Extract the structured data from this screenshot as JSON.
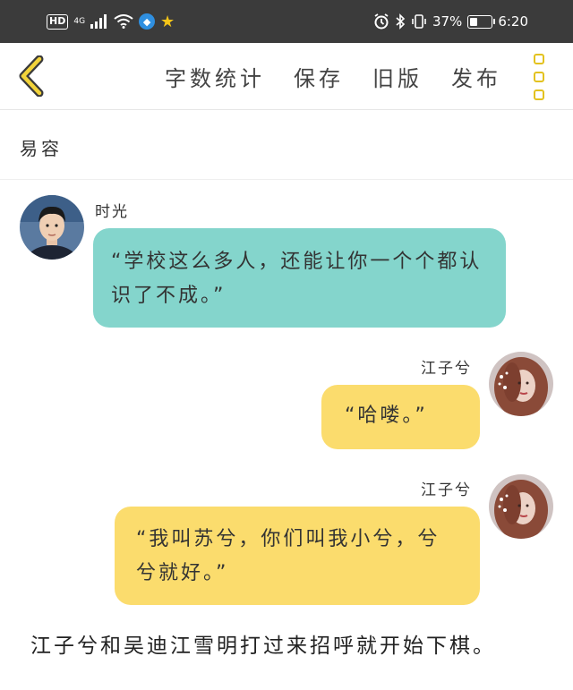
{
  "status_bar": {
    "hd": "HD",
    "signal_type": "4G",
    "battery_percent": "37%",
    "time": "6:20",
    "battery_level": 0.37
  },
  "toolbar": {
    "back_icon": "chevron-left-icon",
    "actions": [
      "字数统计",
      "保存",
      "旧版",
      "发布"
    ],
    "more_icon": "more-vertical-icon",
    "accent_color": "#e3c21f"
  },
  "chapter": {
    "title": "易容"
  },
  "messages": [
    {
      "speaker": "时光",
      "side": "left",
      "text": "“学校这么多人，还能让你一个个都认识了不成。”",
      "color": "#84d5cc"
    },
    {
      "speaker": "江子兮",
      "side": "right",
      "text": "“哈喽。”",
      "color": "#fbdc6d"
    },
    {
      "speaker": "江子兮",
      "side": "right",
      "text": "“我叫苏兮，你们叫我小兮，兮兮就好。”",
      "color": "#fbdc6d"
    }
  ],
  "narration": "江子兮和吴迪江雪明打过来招呼就开始下棋。"
}
